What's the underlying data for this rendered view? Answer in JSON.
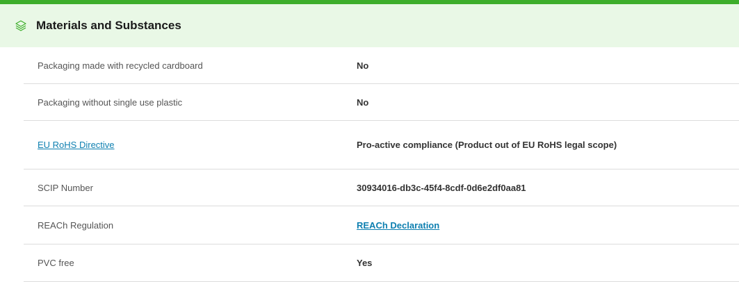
{
  "section": {
    "title": "Materials and Substances",
    "icon": "layers-icon",
    "accent_color": "#3dae2b",
    "header_bg": "#e9f8e6",
    "link_color": "#0d7fb0"
  },
  "rows": [
    {
      "label": "Packaging made with recycled cardboard",
      "value": "No"
    },
    {
      "label": "Packaging without single use plastic",
      "value": "No"
    },
    {
      "label": "EU RoHS Directive",
      "value": "Pro-active compliance (Product out of EU RoHS legal scope)"
    },
    {
      "label": "SCIP Number",
      "value": "30934016-db3c-45f4-8cdf-0d6e2df0aa81"
    },
    {
      "label": "REACh Regulation",
      "value": "REACh Declaration"
    },
    {
      "label": "PVC free",
      "value": "Yes"
    }
  ]
}
